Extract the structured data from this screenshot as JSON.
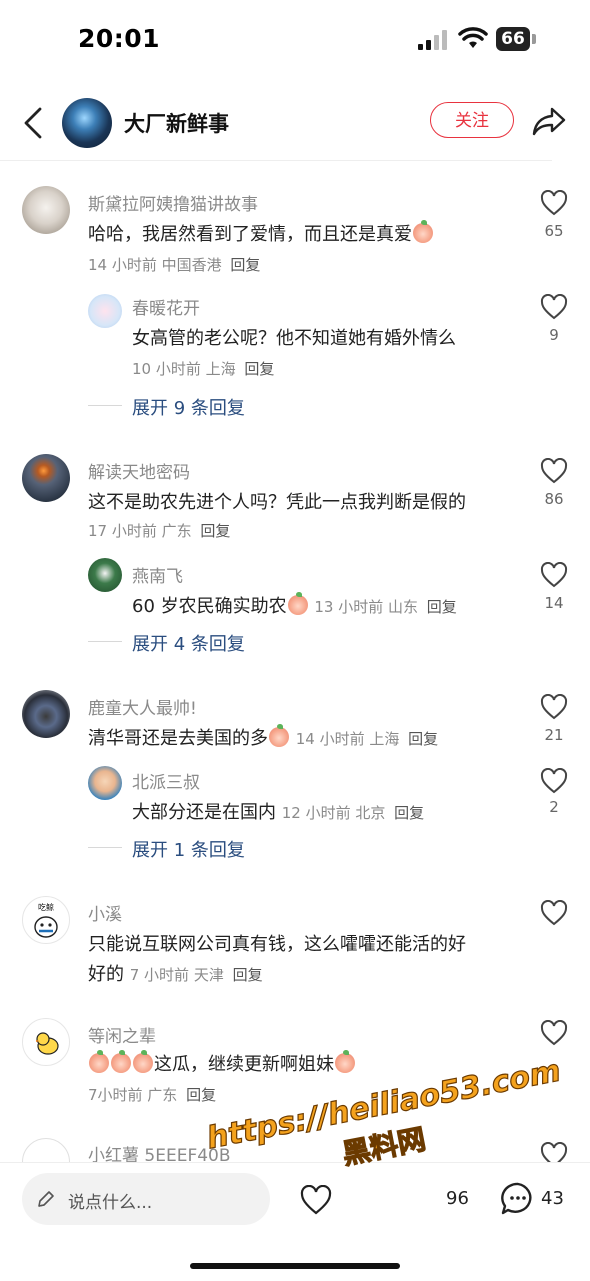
{
  "status": {
    "time": "20:01",
    "battery": "66"
  },
  "header": {
    "title": "大厂新鲜事",
    "follow_label": "关注"
  },
  "comments": [
    {
      "user": "斯黛拉阿姨撸猫讲故事",
      "text": "哈哈，我居然看到了爱情，而且还是真爱",
      "meta": "14 小时前 中国香港",
      "reply": "回复",
      "likes": "65",
      "sub": {
        "user": "春暖花开",
        "text": "女高管的老公呢？他不知道她有婚外情么",
        "meta": "10 小时前 上海",
        "reply": "回复",
        "likes": "9"
      },
      "expand": "展开 9 条回复"
    },
    {
      "user": "解读天地密码",
      "text": "这不是助农先进个人吗？凭此一点我判断是假的",
      "meta": "17 小时前 广东",
      "reply": "回复",
      "likes": "86",
      "sub": {
        "user": "燕南飞",
        "text": "60 岁农民确实助农",
        "meta": "13 小时前 山东",
        "reply": "回复",
        "likes": "14"
      },
      "expand": "展开 4 条回复"
    },
    {
      "user": "鹿童大人最帅!",
      "text": "清华哥还是去美国的多",
      "meta": "14 小时前 上海",
      "reply": "回复",
      "likes": "21",
      "sub": {
        "user": "北派三叔",
        "text": "大部分还是在国内",
        "meta": "12 小时前 北京",
        "reply": "回复",
        "likes": "2"
      },
      "expand": "展开 1 条回复"
    },
    {
      "user": "小溪",
      "text_line1": "只能说互联网公司真有钱，这么嚯嚯还能活的好",
      "text_line2": "好的",
      "meta": "7 小时前 天津",
      "reply": "回复",
      "avatar_label": "吃鲸"
    },
    {
      "user": "等闲之辈",
      "text": "这瓜，继续更新啊姐妹",
      "meta": "7小时前 广东",
      "reply": "回复"
    },
    {
      "user": "小红薯 5EEEF40B"
    }
  ],
  "bottom": {
    "placeholder": "说点什么...",
    "star_count": "96",
    "comment_count": "43"
  },
  "watermark": {
    "url": "https://heiliao53.com",
    "name": "黑料网"
  },
  "colors": {
    "accent_red": "#e8333f",
    "link_blue": "#2a4d7f",
    "watermark_orange": "#f4a21d"
  }
}
